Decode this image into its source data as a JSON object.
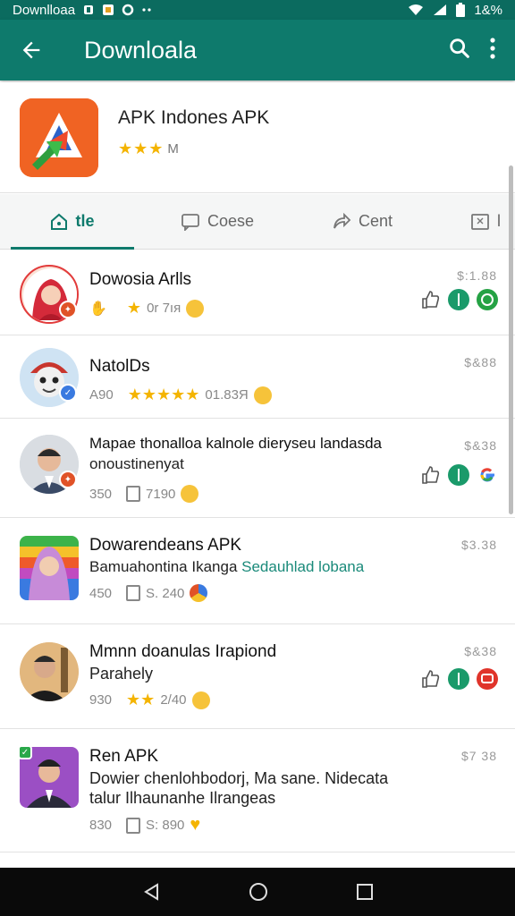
{
  "status_bar": {
    "app_label": "Downlloaa",
    "battery": "1&%"
  },
  "appbar": {
    "title": "Downloala"
  },
  "app": {
    "name": "APK Indones APK",
    "rating_text": "M",
    "rating_stars": 3
  },
  "tabs": [
    {
      "label": "tle",
      "icon": "home-icon",
      "active": true
    },
    {
      "label": "Coese",
      "icon": "chat-icon",
      "active": false
    },
    {
      "label": "Cent",
      "icon": "share-icon",
      "active": false
    },
    {
      "label": "l",
      "icon": "screen-icon",
      "active": false
    }
  ],
  "items": [
    {
      "title": "Dowosia Arlls",
      "subtitle": "",
      "meta_count": "",
      "meta_text": "0r 7ıя",
      "stars": 1,
      "price": "$:1.88",
      "actions": [
        "thumb-up-icon",
        "green-download-icon",
        "whatsapp-icon"
      ],
      "badge_color": "#d94a2a"
    },
    {
      "title": "NatolDs",
      "subtitle": "",
      "meta_count": "A90",
      "meta_text": "01.83Я",
      "stars": 5,
      "price": "$&88",
      "actions": [],
      "badge_color": "#2a6fd9"
    },
    {
      "title": "Mapae thonalloa kalnole dieryseu landasda",
      "subtitle": "onoustinenyat",
      "meta_count": "350",
      "meta_text": "7190",
      "stars": 0,
      "price": "$&38",
      "actions": [
        "thumb-up-icon",
        "green-download-icon",
        "google-icon"
      ],
      "badge_color": "#d94a2a"
    },
    {
      "title": "Dowarendeans APK",
      "subtitle_a": "Bamuahontina Ikanga",
      "subtitle_b": "Sedauhlad lobana",
      "meta_count": "450",
      "meta_text": "S. 240",
      "stars": 0,
      "price": "$3.38",
      "actions": [],
      "badge_color": ""
    },
    {
      "title": "Mmnn doanulas Irapiond",
      "subtitle": "Parahely",
      "meta_count": "930",
      "meta_text": "2/40",
      "stars": 2,
      "price": "$&38",
      "actions": [
        "thumb-up-icon",
        "green-download-icon",
        "red-chat-icon"
      ],
      "badge_color": ""
    },
    {
      "title": "Ren APK",
      "subtitle": "Dowier chenlohbodorj, Ma sane. Nidecata",
      "subtitle2": "talur Ilhaunanhe Ilrangeas",
      "meta_count": "830",
      "meta_text": "S: 890",
      "stars": 0,
      "price": "$7 38",
      "actions": [],
      "badge_color": "#2aa84a"
    }
  ],
  "colors": {
    "primary": "#0e7a6c",
    "status": "#0b6b5f",
    "star": "#f4b400",
    "logo": "#f06323"
  }
}
